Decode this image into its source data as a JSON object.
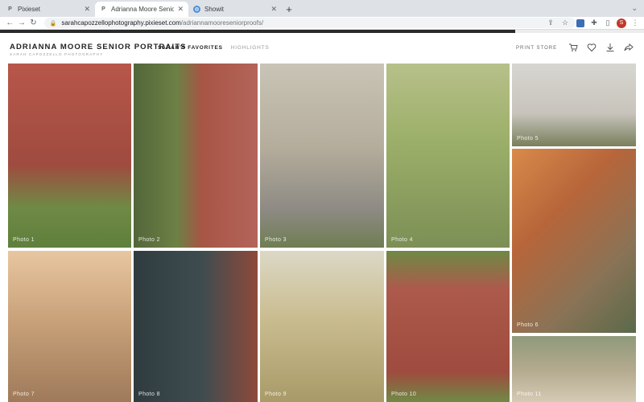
{
  "browser": {
    "tabs": [
      {
        "label": "Pixieset",
        "favicon": "P",
        "active": false
      },
      {
        "label": "Adrianna Moore Senior Portraits",
        "favicon": "P",
        "active": true
      },
      {
        "label": "Showit",
        "favicon": "globe",
        "active": false
      }
    ],
    "url_host": "sarahcapozzellophotography.pixieset.com",
    "url_path": "/adriannamooreseniorproofs/",
    "profile_initial": "S"
  },
  "gallery": {
    "title": "ADRIANNA MOORE SENIOR PORTRAITS",
    "subtitle": "SARAH CAPOZZELLO PHOTOGRAPHY",
    "nav": [
      {
        "label": "SARAH'S FAVORITES",
        "active": true
      },
      {
        "label": "HIGHLIGHTS",
        "active": false
      }
    ],
    "print_store_label": "PRINT STORE",
    "progress_fraction": 0.8,
    "progress_color": "#2a2a2a",
    "icons": [
      "cart-icon",
      "heart-icon",
      "download-icon",
      "share-icon"
    ]
  },
  "photos": [
    {
      "label": "Photo 1",
      "style": "ph-brick"
    },
    {
      "label": "Photo 2",
      "style": "ph-wall"
    },
    {
      "label": "Photo 3",
      "style": "ph-arch"
    },
    {
      "label": "Photo 4",
      "style": "ph-willow"
    },
    {
      "label": "Photo 5",
      "style": "ph-sit"
    },
    {
      "label": "Photo 6",
      "style": "ph-autumn"
    },
    {
      "label": "Photo 7",
      "style": "ph-leaves"
    },
    {
      "label": "Photo 8",
      "style": "ph-gate"
    },
    {
      "label": "Photo 9",
      "style": "ph-field"
    },
    {
      "label": "Photo 10",
      "style": "ph-brick2"
    },
    {
      "label": "Photo 11",
      "style": "ph-tree"
    }
  ]
}
